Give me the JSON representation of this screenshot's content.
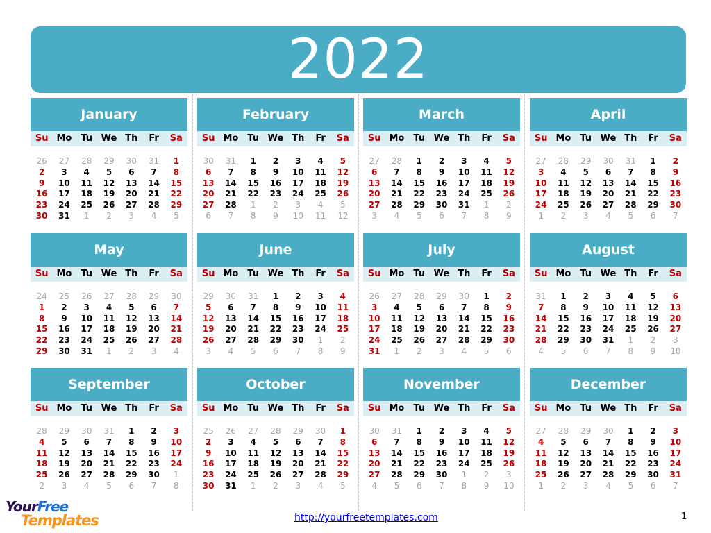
{
  "title": "2022",
  "weekdays": [
    "Su",
    "Mo",
    "Tu",
    "We",
    "Th",
    "Fr",
    "Sa"
  ],
  "colors": {
    "accent": "#4bacc6",
    "weekday_bg": "#dbeef4",
    "weekend": "#c00000",
    "other_month": "#a6a6a6"
  },
  "months": [
    {
      "name": "January",
      "lead": [
        26,
        27,
        28,
        29,
        30,
        31
      ],
      "count": 31,
      "trail": [
        1,
        2,
        3,
        4,
        5
      ]
    },
    {
      "name": "February",
      "lead": [
        30,
        31
      ],
      "count": 28,
      "trail": [
        1,
        2,
        3,
        4,
        5,
        6,
        7,
        8,
        9,
        10,
        11,
        12
      ]
    },
    {
      "name": "March",
      "lead": [
        27,
        28
      ],
      "count": 31,
      "trail": [
        1,
        2,
        3,
        4,
        5,
        6,
        7,
        8,
        9
      ]
    },
    {
      "name": "April",
      "lead": [
        27,
        28,
        29,
        30,
        31
      ],
      "count": 30,
      "trail": [
        1,
        2,
        3,
        4,
        5,
        6,
        7
      ]
    },
    {
      "name": "May",
      "lead": [
        24,
        25,
        26,
        27,
        28,
        29,
        30
      ],
      "count": 31,
      "trail": [
        1,
        2,
        3,
        4
      ]
    },
    {
      "name": "June",
      "lead": [
        29,
        30,
        31
      ],
      "count": 30,
      "trail": [
        1,
        2,
        3,
        4,
        5,
        6,
        7,
        8,
        9
      ]
    },
    {
      "name": "July",
      "lead": [
        26,
        27,
        28,
        29,
        30
      ],
      "count": 31,
      "trail": [
        1,
        2,
        3,
        4,
        5,
        6
      ]
    },
    {
      "name": "August",
      "lead": [
        31
      ],
      "count": 31,
      "trail": [
        1,
        2,
        3,
        4,
        5,
        6,
        7,
        8,
        9,
        10
      ]
    },
    {
      "name": "September",
      "lead": [
        28,
        29,
        30,
        31
      ],
      "count": 30,
      "trail": [
        1,
        2,
        3,
        4,
        5,
        6,
        7,
        8
      ]
    },
    {
      "name": "October",
      "lead": [
        25,
        26,
        27,
        28,
        29,
        30
      ],
      "count": 31,
      "trail": [
        1,
        2,
        3,
        4,
        5
      ]
    },
    {
      "name": "November",
      "lead": [
        30,
        31
      ],
      "count": 30,
      "trail": [
        1,
        2,
        3,
        4,
        5,
        6,
        7,
        8,
        9,
        10
      ]
    },
    {
      "name": "December",
      "lead": [
        27,
        28,
        29,
        30
      ],
      "count": 31,
      "trail": [
        1,
        2,
        3,
        4,
        5,
        6,
        7
      ]
    }
  ],
  "footer": {
    "logo_line1_a": "Your",
    "logo_line1_b": "Free",
    "logo_line2": "Templates",
    "link": "http://yourfreetemplates.com",
    "page_number": "1"
  }
}
